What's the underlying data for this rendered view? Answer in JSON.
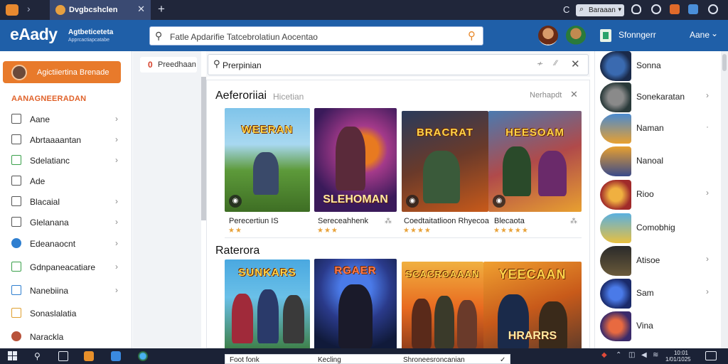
{
  "browser": {
    "tab_title": "Dvgbcshclen",
    "new_tab": "+",
    "tab_close": "✕",
    "mini_label": "Baraaan"
  },
  "header": {
    "logo": "eAady",
    "logo_sub": "Agtbeticeteta",
    "logo_sub2": "Apprcactiapcatabe",
    "search_placeholder": "Fatle Apdarifie   Tatcebrolatiun Aocentao",
    "user_name": "Sfonngerr",
    "language": "Aane",
    "accent": "#1f5fa8",
    "brand_orange": "#e87a2b"
  },
  "sidebar": {
    "cta_label": "Agictiiertina Brenade",
    "section_title": "AANAGNEERADAN",
    "items": [
      {
        "label": "Aane",
        "icon": "gamepad-icon",
        "chevron": "›"
      },
      {
        "label": "Abrtaaaantan",
        "icon": "controller-icon",
        "chevron": "›"
      },
      {
        "label": "Sdelatianc",
        "icon": "folder-icon",
        "chevron": "›"
      },
      {
        "label": "Ade",
        "icon": "game-icon",
        "chevron": ""
      },
      {
        "label": "Blacaial",
        "icon": "document-icon",
        "chevron": "›"
      },
      {
        "label": "Glelanana",
        "icon": "list-icon",
        "chevron": "›"
      },
      {
        "label": "Edeanaocnt",
        "icon": "circle-icon",
        "chevron": "›"
      },
      {
        "label": "Gdnpaneacatiare",
        "icon": "chart-icon",
        "chevron": "›"
      },
      {
        "label": "Nanebiina",
        "icon": "grid-icon",
        "chevron": "›"
      },
      {
        "label": "Sonaslalatia",
        "icon": "chat-icon",
        "chevron": ""
      },
      {
        "label": "Narackla",
        "icon": "profile-icon",
        "chevron": ""
      }
    ]
  },
  "filters": {
    "pill_count": "0",
    "pill_label": "Preedhaan",
    "search_label": "Prerpinian",
    "tool1": "≁",
    "tool2": "⁄⁄"
  },
  "main": {
    "section1_title": "Aeferoriiai",
    "section1_sub": "Hicetian",
    "more": "Nerhapdt",
    "section2_title": "Raterora",
    "cards_row1": [
      {
        "art": "WEERAN",
        "art2": "",
        "caption": "Perecertiun IS",
        "stars": "★★"
      },
      {
        "art": "",
        "art2": "SLEHOMAN",
        "caption": "Sereceahhenk",
        "stars": "★★★"
      },
      {
        "art": "BRACRAT",
        "art2": "",
        "caption": "Coedtaitatlioon Rhyecoa",
        "stars": "★★★★"
      },
      {
        "art": "HEESOAM",
        "art2": "",
        "caption": "Blecaota",
        "stars": "★★★★★"
      }
    ],
    "cards_row2": [
      {
        "art": "SUNKARS",
        "art2": ""
      },
      {
        "art": "RGAER",
        "art2": ""
      },
      {
        "art": "SCACROAAAN",
        "art2": ""
      },
      {
        "art": "YEECAAN",
        "art2": "HRARRS"
      }
    ],
    "popup": [
      "Foot fonk",
      "Kecling",
      "Shroneesroncanian"
    ]
  },
  "right_list": [
    {
      "label": "Sonna",
      "chevron": ""
    },
    {
      "label": "Sonekaratan",
      "chevron": "›"
    },
    {
      "label": "Naman",
      "chevron": "·"
    },
    {
      "label": "Nanoal",
      "chevron": ""
    },
    {
      "label": "Rioo",
      "chevron": "›"
    },
    {
      "label": "Comobhig",
      "chevron": ""
    },
    {
      "label": "Atisoe",
      "chevron": "›"
    },
    {
      "label": "Sam",
      "chevron": "›"
    },
    {
      "label": "Vina",
      "chevron": ""
    }
  ],
  "taskbar": {
    "clock_time": "10:01",
    "clock_date": "1/01/1025"
  }
}
